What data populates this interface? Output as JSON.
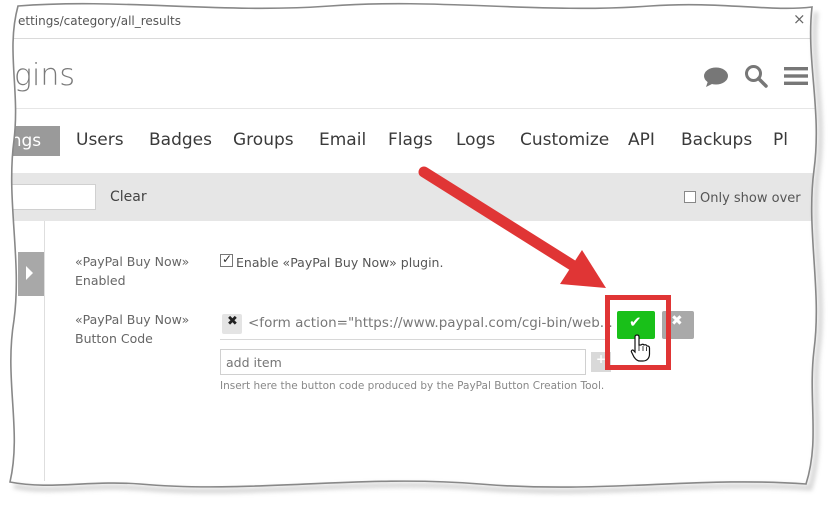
{
  "browser": {
    "url": "ettings/category/all_results",
    "close_glyph": "×"
  },
  "header": {
    "title": "gins",
    "icons": [
      "chat-bubble-icon",
      "search-icon",
      "hamburger-menu-icon"
    ]
  },
  "nav": {
    "items": [
      {
        "label": "ings",
        "active": true
      },
      {
        "label": "Users"
      },
      {
        "label": "Badges"
      },
      {
        "label": "Groups"
      },
      {
        "label": "Email"
      },
      {
        "label": "Flags"
      },
      {
        "label": "Logs"
      },
      {
        "label": "Customize"
      },
      {
        "label": "API"
      },
      {
        "label": "Backups"
      },
      {
        "label": "Pl"
      }
    ]
  },
  "filter": {
    "input_value": "",
    "clear_label": "Clear",
    "only_show_label": "Only show over"
  },
  "settings": {
    "enabled": {
      "label_line1": "«PayPal Buy Now»",
      "label_line2": "Enabled",
      "checked": true,
      "check_glyph": "✓",
      "checkbox_label": "Enable «PayPal Buy Now» plugin."
    },
    "button_code": {
      "label_line1": "«PayPal Buy Now»",
      "label_line2": "Button Code",
      "value": "<form action=\"https://www.paypal.com/cgi-bin/web...",
      "remove_glyph": "✖",
      "save_glyph": "✔",
      "cancel_glyph": "✖",
      "add_placeholder": "add item",
      "add_glyph": "+",
      "help_text": "Insert here the button code produced by the PayPal Button Creation Tool."
    }
  },
  "annotation": {
    "arrow_color": "#e03535",
    "highlight_color": "#e03535"
  },
  "colors": {
    "save_green": "#19c019",
    "nav_active_bg": "#9a9a9a",
    "filter_bar_bg": "#e6e6e6"
  }
}
